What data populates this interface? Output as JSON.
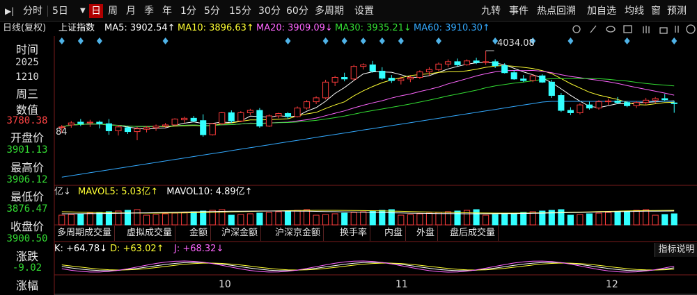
{
  "toolbar": {
    "left_items": [
      "分时",
      "5日",
      "日",
      "周",
      "月",
      "季",
      "年",
      "1分",
      "5分",
      "15分",
      "30分",
      "60分",
      "多周期",
      "设置"
    ],
    "selected": "日",
    "right_items": [
      "九转",
      "事件",
      "热点回溯",
      "加自选",
      "均线",
      "窗",
      "预测"
    ]
  },
  "info": {
    "period": "日线(复权)",
    "index_name": "上证指数",
    "ma5": "MA5: 3902.54↑",
    "ma10": "MA10: 3896.63↑",
    "ma20": "MA20: 3909.09↓",
    "ma30": "MA30: 3935.21↓",
    "ma60": "MA60: 3910.30↑"
  },
  "sidebar": {
    "time_label": "时间",
    "year": "2025",
    "date": "1210",
    "weekday": "周三",
    "value_label": "数值",
    "value": "3780.38",
    "open_label": "开盘价",
    "open": "3901.13",
    "high_label": "最高价",
    "high": "3906.12",
    "low_label": "最低价",
    "low": "3876.47",
    "close_label": "收盘价",
    "close": "3900.50",
    "change_label": "涨跌",
    "change": "-9.02",
    "pct_label": "涨幅"
  },
  "annotations": {
    "peak": "4034.08",
    "left_edge": "84"
  },
  "volume": {
    "prefix": "亿↓",
    "mavol5": "MAVOL5: 5.03亿↑",
    "mavol10": "MAVOL10: 4.89亿↑"
  },
  "tabs": [
    "多周期成交量",
    "虚拟成交量",
    "金额",
    "沪深金额",
    "沪深京金额",
    "换手率",
    "内盘",
    "外盘",
    "盘后成交量"
  ],
  "kdj": {
    "k": "K: +64.78↓",
    "d": "D: +63.02↑",
    "j": "J: +68.32↓",
    "help": "指标说明"
  },
  "xaxis": [
    "10",
    "11",
    "12"
  ],
  "colors": {
    "up": "#ff3c3c",
    "down": "#33ffff",
    "ma5": "#ffffff",
    "ma10": "#ffff33",
    "ma20": "#ff66ff",
    "ma30": "#33dd33",
    "ma60": "#33aaff"
  },
  "chart_data": {
    "type": "candlestick",
    "series": [
      {
        "name": "OHLC",
        "values": [
          [
            3840,
            3845,
            3824,
            3840
          ],
          [
            3845,
            3855,
            3838,
            3850
          ],
          [
            3852,
            3860,
            3842,
            3848
          ],
          [
            3850,
            3858,
            3840,
            3852
          ],
          [
            3852,
            3856,
            3836,
            3848
          ],
          [
            3848,
            3860,
            3820,
            3830
          ],
          [
            3830,
            3845,
            3818,
            3840
          ],
          [
            3838,
            3842,
            3822,
            3828
          ],
          [
            3828,
            3840,
            3806,
            3835
          ],
          [
            3834,
            3842,
            3826,
            3838
          ],
          [
            3838,
            3846,
            3830,
            3842
          ],
          [
            3842,
            3850,
            3838,
            3845
          ],
          [
            3845,
            3862,
            3842,
            3860
          ],
          [
            3858,
            3866,
            3850,
            3862
          ],
          [
            3862,
            3868,
            3852,
            3855
          ],
          [
            3856,
            3872,
            3815,
            3820
          ],
          [
            3820,
            3850,
            3818,
            3848
          ],
          [
            3848,
            3878,
            3845,
            3876
          ],
          [
            3876,
            3882,
            3850,
            3855
          ],
          [
            3855,
            3880,
            3852,
            3876
          ],
          [
            3876,
            3886,
            3870,
            3882
          ],
          [
            3882,
            3888,
            3838,
            3842
          ],
          [
            3842,
            3872,
            3840,
            3868
          ],
          [
            3868,
            3876,
            3862,
            3874
          ],
          [
            3874,
            3878,
            3860,
            3866
          ],
          [
            3866,
            3892,
            3864,
            3888
          ],
          [
            3888,
            3908,
            3884,
            3904
          ],
          [
            3904,
            3918,
            3898,
            3914
          ],
          [
            3914,
            3960,
            3910,
            3954
          ],
          [
            3954,
            3970,
            3944,
            3966
          ],
          [
            3966,
            3978,
            3956,
            3962
          ],
          [
            3962,
            3998,
            3958,
            3994
          ],
          [
            3994,
            4002,
            3986,
            3998
          ],
          [
            3998,
            4008,
            3978,
            3982
          ],
          [
            3982,
            3992,
            3960,
            3964
          ],
          [
            3964,
            3972,
            3952,
            3958
          ],
          [
            3958,
            3968,
            3948,
            3962
          ],
          [
            3962,
            3970,
            3954,
            3966
          ],
          [
            3966,
            3984,
            3962,
            3980
          ],
          [
            3980,
            3992,
            3970,
            3986
          ],
          [
            3986,
            4004,
            3982,
            4000
          ],
          [
            4000,
            4012,
            3992,
            4006
          ],
          [
            4006,
            4014,
            3994,
            3998
          ],
          [
            3998,
            4012,
            3996,
            4008
          ],
          [
            4008,
            4016,
            4000,
            4004
          ],
          [
            4004,
            4034,
            3998,
            4006
          ],
          [
            4006,
            4012,
            3990,
            3996
          ],
          [
            3996,
            4002,
            3976,
            3978
          ],
          [
            3978,
            3984,
            3960,
            3962
          ],
          [
            3962,
            3972,
            3954,
            3958
          ],
          [
            3958,
            3974,
            3954,
            3970
          ],
          [
            3970,
            3974,
            3952,
            3954
          ],
          [
            3954,
            3960,
            3914,
            3920
          ],
          [
            3920,
            3926,
            3878,
            3882
          ],
          [
            3882,
            3890,
            3870,
            3876
          ],
          [
            3876,
            3900,
            3872,
            3896
          ],
          [
            3896,
            3904,
            3884,
            3888
          ],
          [
            3888,
            3908,
            3884,
            3904
          ],
          [
            3904,
            3912,
            3896,
            3906
          ],
          [
            3906,
            3916,
            3898,
            3902
          ],
          [
            3902,
            3906,
            3890,
            3894
          ],
          [
            3894,
            3906,
            3888,
            3902
          ],
          [
            3902,
            3914,
            3896,
            3908
          ],
          [
            3908,
            3916,
            3900,
            3912
          ],
          [
            3912,
            3924,
            3906,
            3909
          ],
          [
            3901,
            3906,
            3876,
            3900
          ]
        ]
      }
    ],
    "markers_up_idx": [
      0,
      2,
      4,
      11,
      24,
      28,
      30,
      32,
      34,
      36,
      40,
      46,
      50,
      54,
      60,
      66
    ],
    "ylim": [
      3700,
      4050
    ]
  }
}
